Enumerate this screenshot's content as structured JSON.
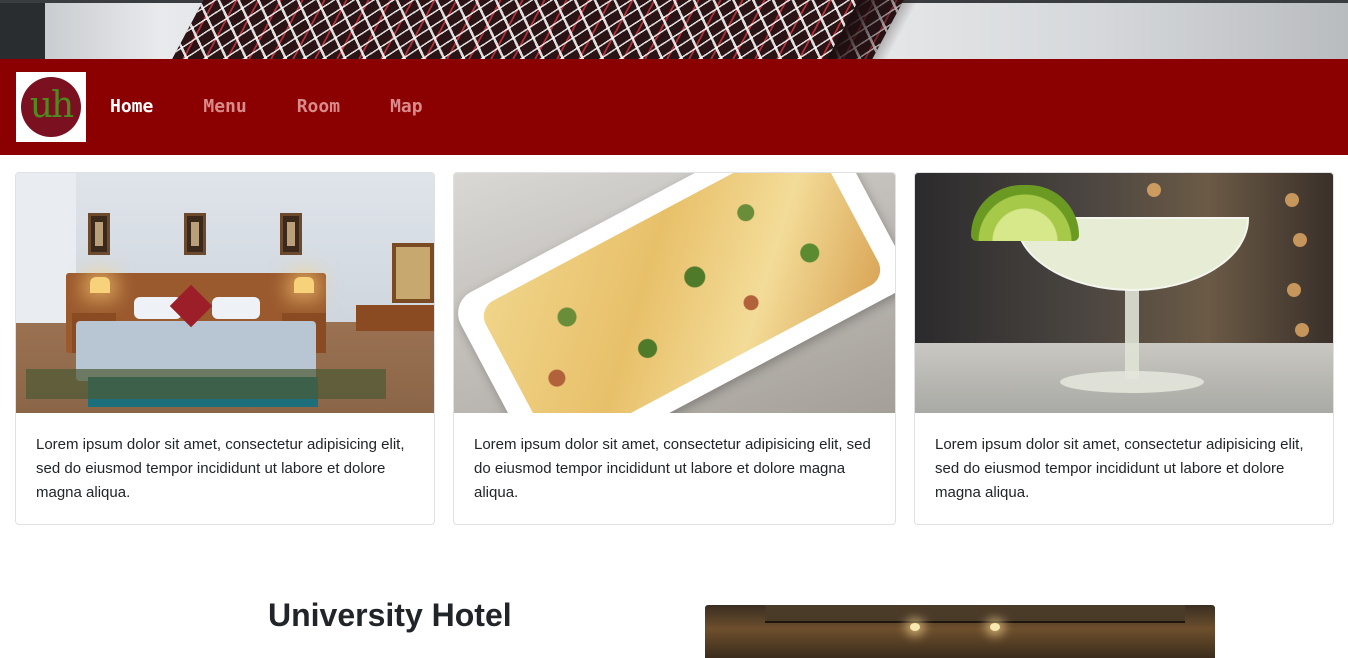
{
  "nav": {
    "logo_text": "uh",
    "items": [
      {
        "label": "Home",
        "active": true
      },
      {
        "label": "Menu",
        "active": false
      },
      {
        "label": "Room",
        "active": false
      },
      {
        "label": "Map",
        "active": false
      }
    ],
    "colors": {
      "bar": "#8b0000",
      "active": "#ffffff",
      "inactive": "#d98a8a"
    }
  },
  "cards": [
    {
      "image": "hotel-bedroom-photo",
      "text": "Lorem ipsum dolor sit amet, consectetur adipisicing elit, sed do eiusmod tempor incididunt ut labore et dolore magna aliqua."
    },
    {
      "image": "baked-casserole-photo",
      "text": "Lorem ipsum dolor sit amet, consectetur adipisicing elit, sed do eiusmod tempor incididunt ut labore et dolore magna aliqua."
    },
    {
      "image": "cocktail-glass-photo",
      "text": "Lorem ipsum dolor sit amet, consectetur adipisicing elit, sed do eiusmod tempor incididunt ut labore et dolore magna aliqua."
    }
  ],
  "about": {
    "title": "University Hotel",
    "image": "hotel-interior-photo"
  }
}
